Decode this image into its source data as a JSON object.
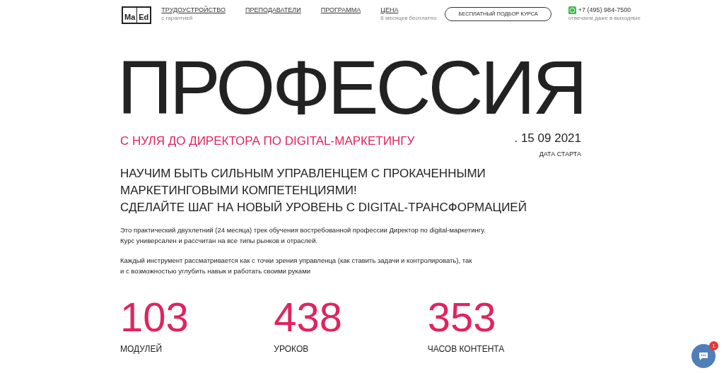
{
  "header": {
    "logo": [
      "Ma",
      "Ed"
    ],
    "nav": [
      {
        "label": "ТРУДОУСТРОЙСТВО",
        "sub": "с гарантией"
      },
      {
        "label": "ПРЕПОДАВАТЕЛИ"
      },
      {
        "label": "ПРОГРАММА"
      },
      {
        "label": "ЦЕНА",
        "sub": "6 месяцев бесплатно"
      }
    ],
    "cta": "БЕСПЛАТНЫЙ ПОДБОР КУРСА",
    "phone": "+7 (495) 984-7500",
    "phone_note": "отвечаем даже в выходные"
  },
  "hero": {
    "title": "ПРОФЕССИЯ",
    "subtitle": "С НУЛЯ ДО ДИРЕКТОРА ПО DIGITAL-МАРКЕТИНГУ",
    "date": ". 15 09 2021",
    "date_label": "ДАТА СТАРТА",
    "headline": [
      "НАУЧИМ БЫТЬ СИЛЬНЫМ УПРАВЛЕНЦЕМ С ПРОКАЧЕННЫМИ",
      "МАРКЕТИНГОВЫМИ КОМПЕТЕНЦИЯМИ!",
      "СДЕЛАЙТЕ ШАГ НА НОВЫЙ УРОВЕНЬ С DIGITAL-ТРАНСФОРМАЦИЕЙ"
    ],
    "paragraphs": [
      [
        "Это практический двухлетний (24 месяца) трек обучения востребованной профессии Директор по digital-маркетингу.",
        "Курс универсален и рассчитан на все типы рынков и отраслей."
      ],
      [
        "Каждый инструмент рассматривается как с точки зрения управленца (как ставить задачи и контролировать), так",
        "и с возможностью углубить навык и работать своими руками"
      ]
    ]
  },
  "stats": [
    {
      "value": "103",
      "label": "МОДУЛЕЙ"
    },
    {
      "value": "438",
      "label": "УРОКОВ"
    },
    {
      "value": "353",
      "label": "ЧАСОВ КОНТЕНТА"
    }
  ],
  "chat": {
    "badge": "1"
  }
}
